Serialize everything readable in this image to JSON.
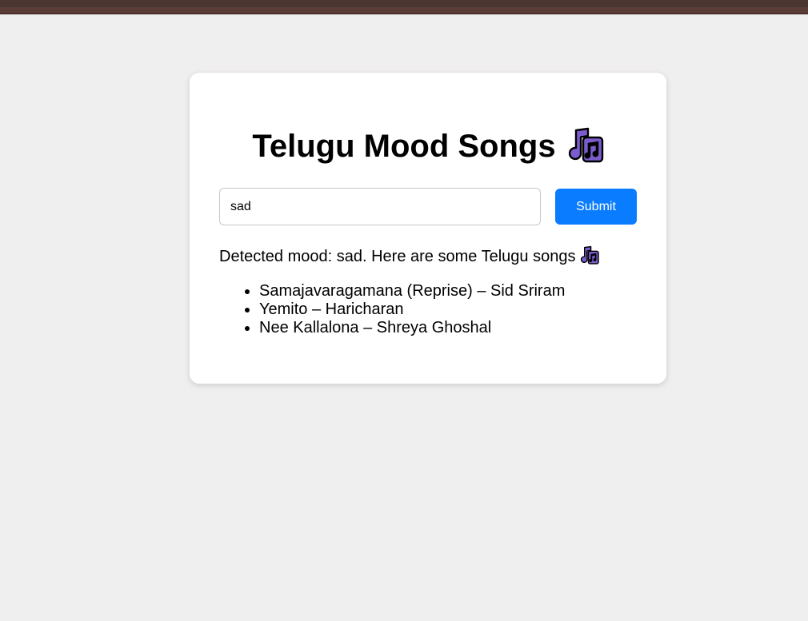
{
  "app": {
    "title": "Telugu Mood Songs",
    "title_icon": "musical-notes-emoji"
  },
  "form": {
    "input_value": "sad",
    "submit_label": "Submit"
  },
  "result": {
    "message": "Detected mood: sad. Here are some Telugu songs",
    "message_icon": "musical-notes-emoji"
  },
  "songs": [
    {
      "label": "Samajavaragamana (Reprise) – Sid Sriram"
    },
    {
      "label": "Yemito – Haricharan"
    },
    {
      "label": "Nee Kallalona – Shreya Ghoshal"
    }
  ],
  "colors": {
    "accent": "#0a7cff",
    "page_background": "#f0efef",
    "top_bar": "#5a3d38",
    "emoji_purple": "#7b5ccc"
  }
}
